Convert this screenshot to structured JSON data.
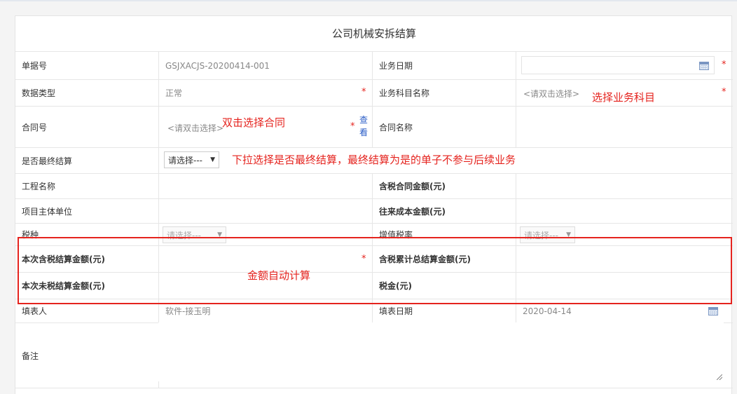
{
  "form": {
    "title": "公司机械安拆结算",
    "rows": {
      "r1": {
        "l1": "单据号",
        "v1": "GSJXACJS-20200414-001",
        "l2": "业务日期"
      },
      "r2": {
        "l1": "数据类型",
        "v1": "正常",
        "l2": "业务科目名称",
        "v2": "<请双击选择>"
      },
      "r3": {
        "l1": "合同号",
        "v1": "<请双击选择>",
        "view_link": "查看",
        "l2": "合同名称"
      },
      "r4": {
        "l1": "是否最终结算",
        "select": "请选择---"
      },
      "r5": {
        "l1": "工程名称",
        "l2": "含税合同金额(元)"
      },
      "r6": {
        "l1": "项目主体单位",
        "l2": "往来成本金额(元)"
      },
      "r7": {
        "l1": "税种",
        "select": "请选择---",
        "l2": "增值税率",
        "select2": "请选择---"
      },
      "r8": {
        "l1": "本次含税结算金额(元)",
        "l2": "含税累计总结算金额(元)"
      },
      "r9": {
        "l1": "本次未税结算金额(元)",
        "l2": "税金(元)"
      },
      "r10": {
        "l1": "填表人",
        "v1": "软件-接玉明",
        "l2": "填表日期",
        "v2": "2020-04-14"
      },
      "r11": {
        "l1": "备注"
      }
    },
    "required_mark": "*"
  },
  "annotations": {
    "business_subject": "选择业务科目",
    "contract": "双击选择合同",
    "final_settlement": "下拉选择是否最终结算，最终结算为是的单子不参与后续业务",
    "auto_calc": "金额自动计算"
  },
  "colors": {
    "annotation": "#e5231e",
    "link": "#2a5cc7",
    "border": "#e6e6e6"
  }
}
